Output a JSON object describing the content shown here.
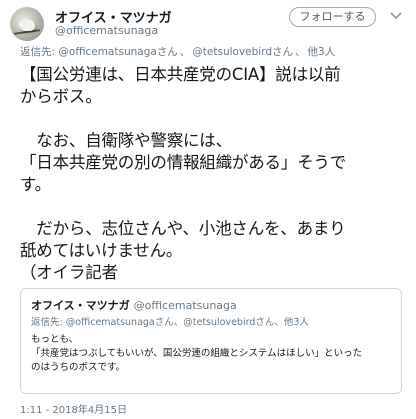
{
  "author": {
    "display_name": "オフイス・マツナガ",
    "handle": "@officematsunaga"
  },
  "follow_button": {
    "label": "フォローする"
  },
  "reply_line": {
    "prefix": "返信先:",
    "mention1": "@officematsunagaさん",
    "mention2": "@tetsulovebirdさん",
    "others": "他3人",
    "separator": "、"
  },
  "tweet_text": "【国公労連は、日本共産党のCIA】説は以前\nからボス。\n\n　なお、自衛隊や警察には、\n「日本共産党の別の情報組織がある」そうで\nす。\n\n　だから、志位さんや、小池さんを、あまり\n舐めてはいけません。\n（オイラ記者",
  "quoted_tweet": {
    "display_name": "オフイス・マツナガ",
    "handle": "@officematsunaga",
    "reply_line": "返信先: @officematsunagaさん、@tetsulovebirdさん、他3人",
    "text": "もっとも、\n「共産党はつぶしてもいいが、国公労連の組織とシステムはほしい」といった\nのはうちのボスです。"
  },
  "timestamp": "1:11 - 2018年4月15日",
  "colors": {
    "secondary_text": "#657786",
    "primary_text": "#14171a",
    "border": "#ccd6dd"
  }
}
